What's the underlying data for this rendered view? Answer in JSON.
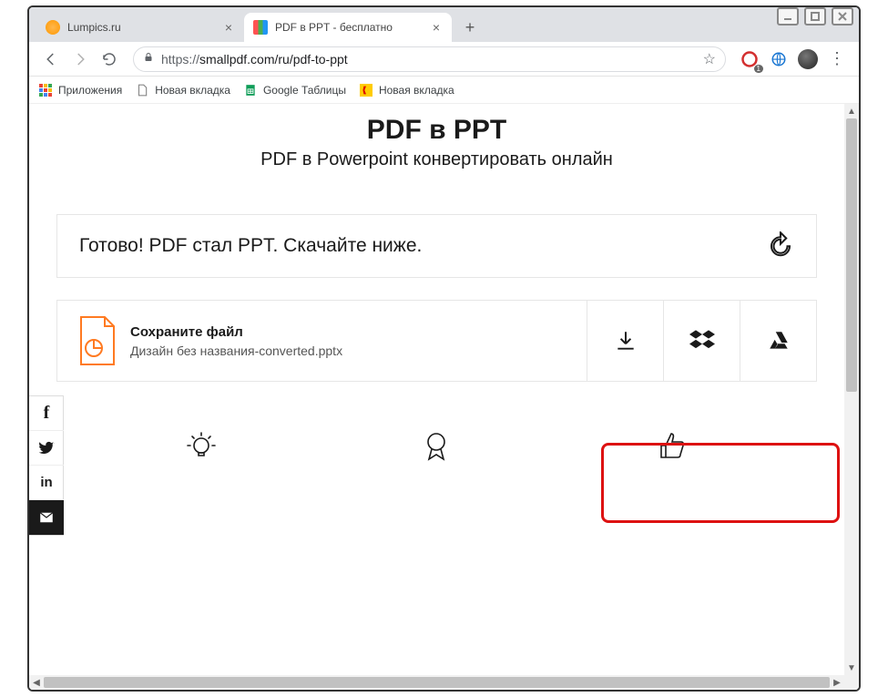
{
  "window": {
    "tabs": [
      {
        "title": "Lumpics.ru",
        "active": false
      },
      {
        "title": "PDF в PPT - бесплатно",
        "active": true
      }
    ]
  },
  "address": {
    "scheme": "https://",
    "host_path": "smallpdf.com/ru/pdf-to-ppt"
  },
  "bookmarks": {
    "apps": "Приложения",
    "b1": "Новая вкладка",
    "b2": "Google Таблицы",
    "b3": "Новая вкладка"
  },
  "page": {
    "title": "PDF в PPT",
    "subtitle": "PDF в Powerpoint конвертировать онлайн",
    "status": "Готово! PDF стал PPT. Скачайте ниже.",
    "save_label": "Сохраните файл",
    "file_name": "Дизайн без названия-converted.pptx"
  },
  "toolbar_badge": "1"
}
